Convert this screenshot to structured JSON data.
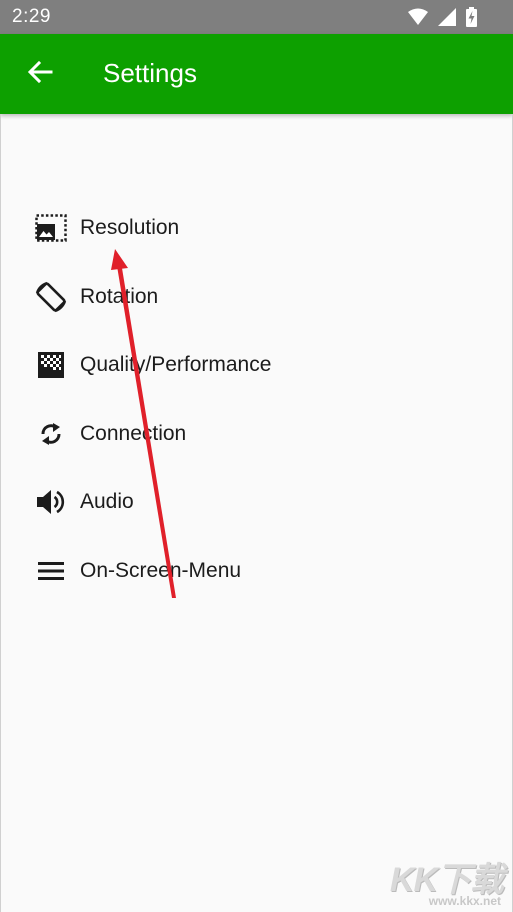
{
  "status_bar": {
    "time": "2:29",
    "icons": [
      "wifi-icon",
      "cellular-signal-icon",
      "battery-charging-icon"
    ]
  },
  "app_bar": {
    "title": "Settings",
    "back_icon": "arrow-back-icon",
    "color": "#0da000"
  },
  "menu": {
    "items": [
      {
        "label": "Resolution",
        "icon": "resolution-icon"
      },
      {
        "label": "Rotation",
        "icon": "screen-rotation-icon"
      },
      {
        "label": "Quality/Performance",
        "icon": "quality-icon"
      },
      {
        "label": "Connection",
        "icon": "sync-icon"
      },
      {
        "label": "Audio",
        "icon": "volume-icon"
      },
      {
        "label": "On-Screen-Menu",
        "icon": "hamburger-menu-icon"
      }
    ]
  },
  "annotation": {
    "arrow_color": "#e0202a"
  },
  "watermark": {
    "logo": "KK下载",
    "url": "www.kkx.net"
  }
}
